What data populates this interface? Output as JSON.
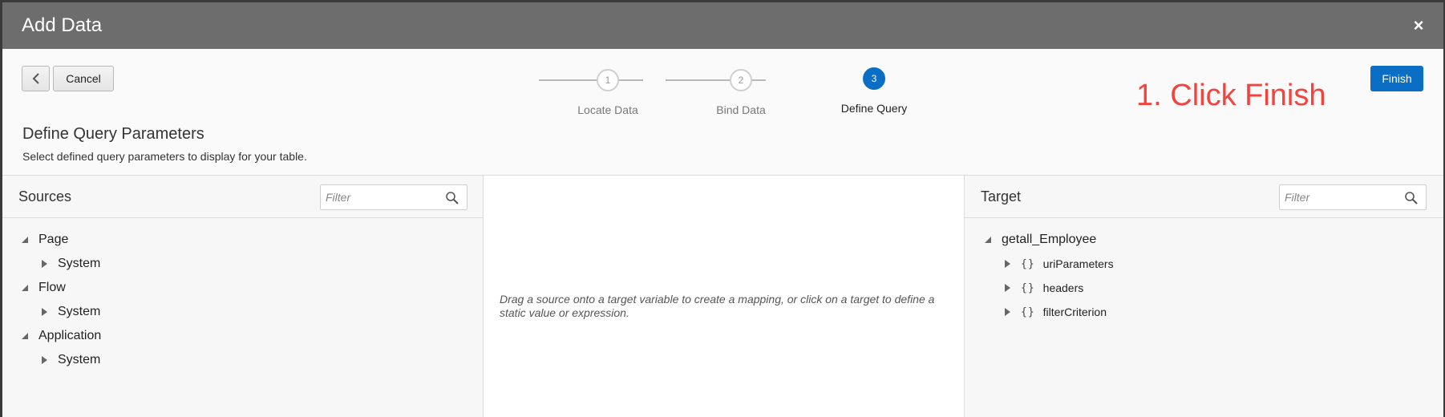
{
  "dialog": {
    "title": "Add Data",
    "close_label": "×"
  },
  "toolbar": {
    "cancel_label": "Cancel",
    "finish_label": "Finish"
  },
  "annotation": "1. Click Finish",
  "train": {
    "stops": [
      {
        "number": "1",
        "label": "Locate Data",
        "active": false
      },
      {
        "number": "2",
        "label": "Bind Data",
        "active": false
      },
      {
        "number": "3",
        "label": "Define Query",
        "active": true
      }
    ]
  },
  "section": {
    "title": "Define Query Parameters",
    "subtitle": "Select defined query parameters to display for your table."
  },
  "sources": {
    "title": "Sources",
    "filter_placeholder": "Filter",
    "tree": [
      {
        "label": "Page",
        "children": [
          {
            "label": "System"
          }
        ]
      },
      {
        "label": "Flow",
        "children": [
          {
            "label": "System"
          }
        ]
      },
      {
        "label": "Application",
        "children": [
          {
            "label": "System"
          }
        ]
      }
    ]
  },
  "mapping": {
    "hint": "Drag a source onto a target variable to create a mapping, or click on a target to define a static value or expression."
  },
  "target": {
    "title": "Target",
    "filter_placeholder": "Filter",
    "root_label": "getall_Employee",
    "children": [
      {
        "braces": "{}",
        "label": "uriParameters"
      },
      {
        "braces": "{}",
        "label": "headers"
      },
      {
        "braces": "{}",
        "label": "filterCriterion"
      }
    ]
  },
  "colors": {
    "titlebar": "#6d6d6d",
    "accent": "#0a6fc4",
    "annotation": "#f2433f"
  }
}
